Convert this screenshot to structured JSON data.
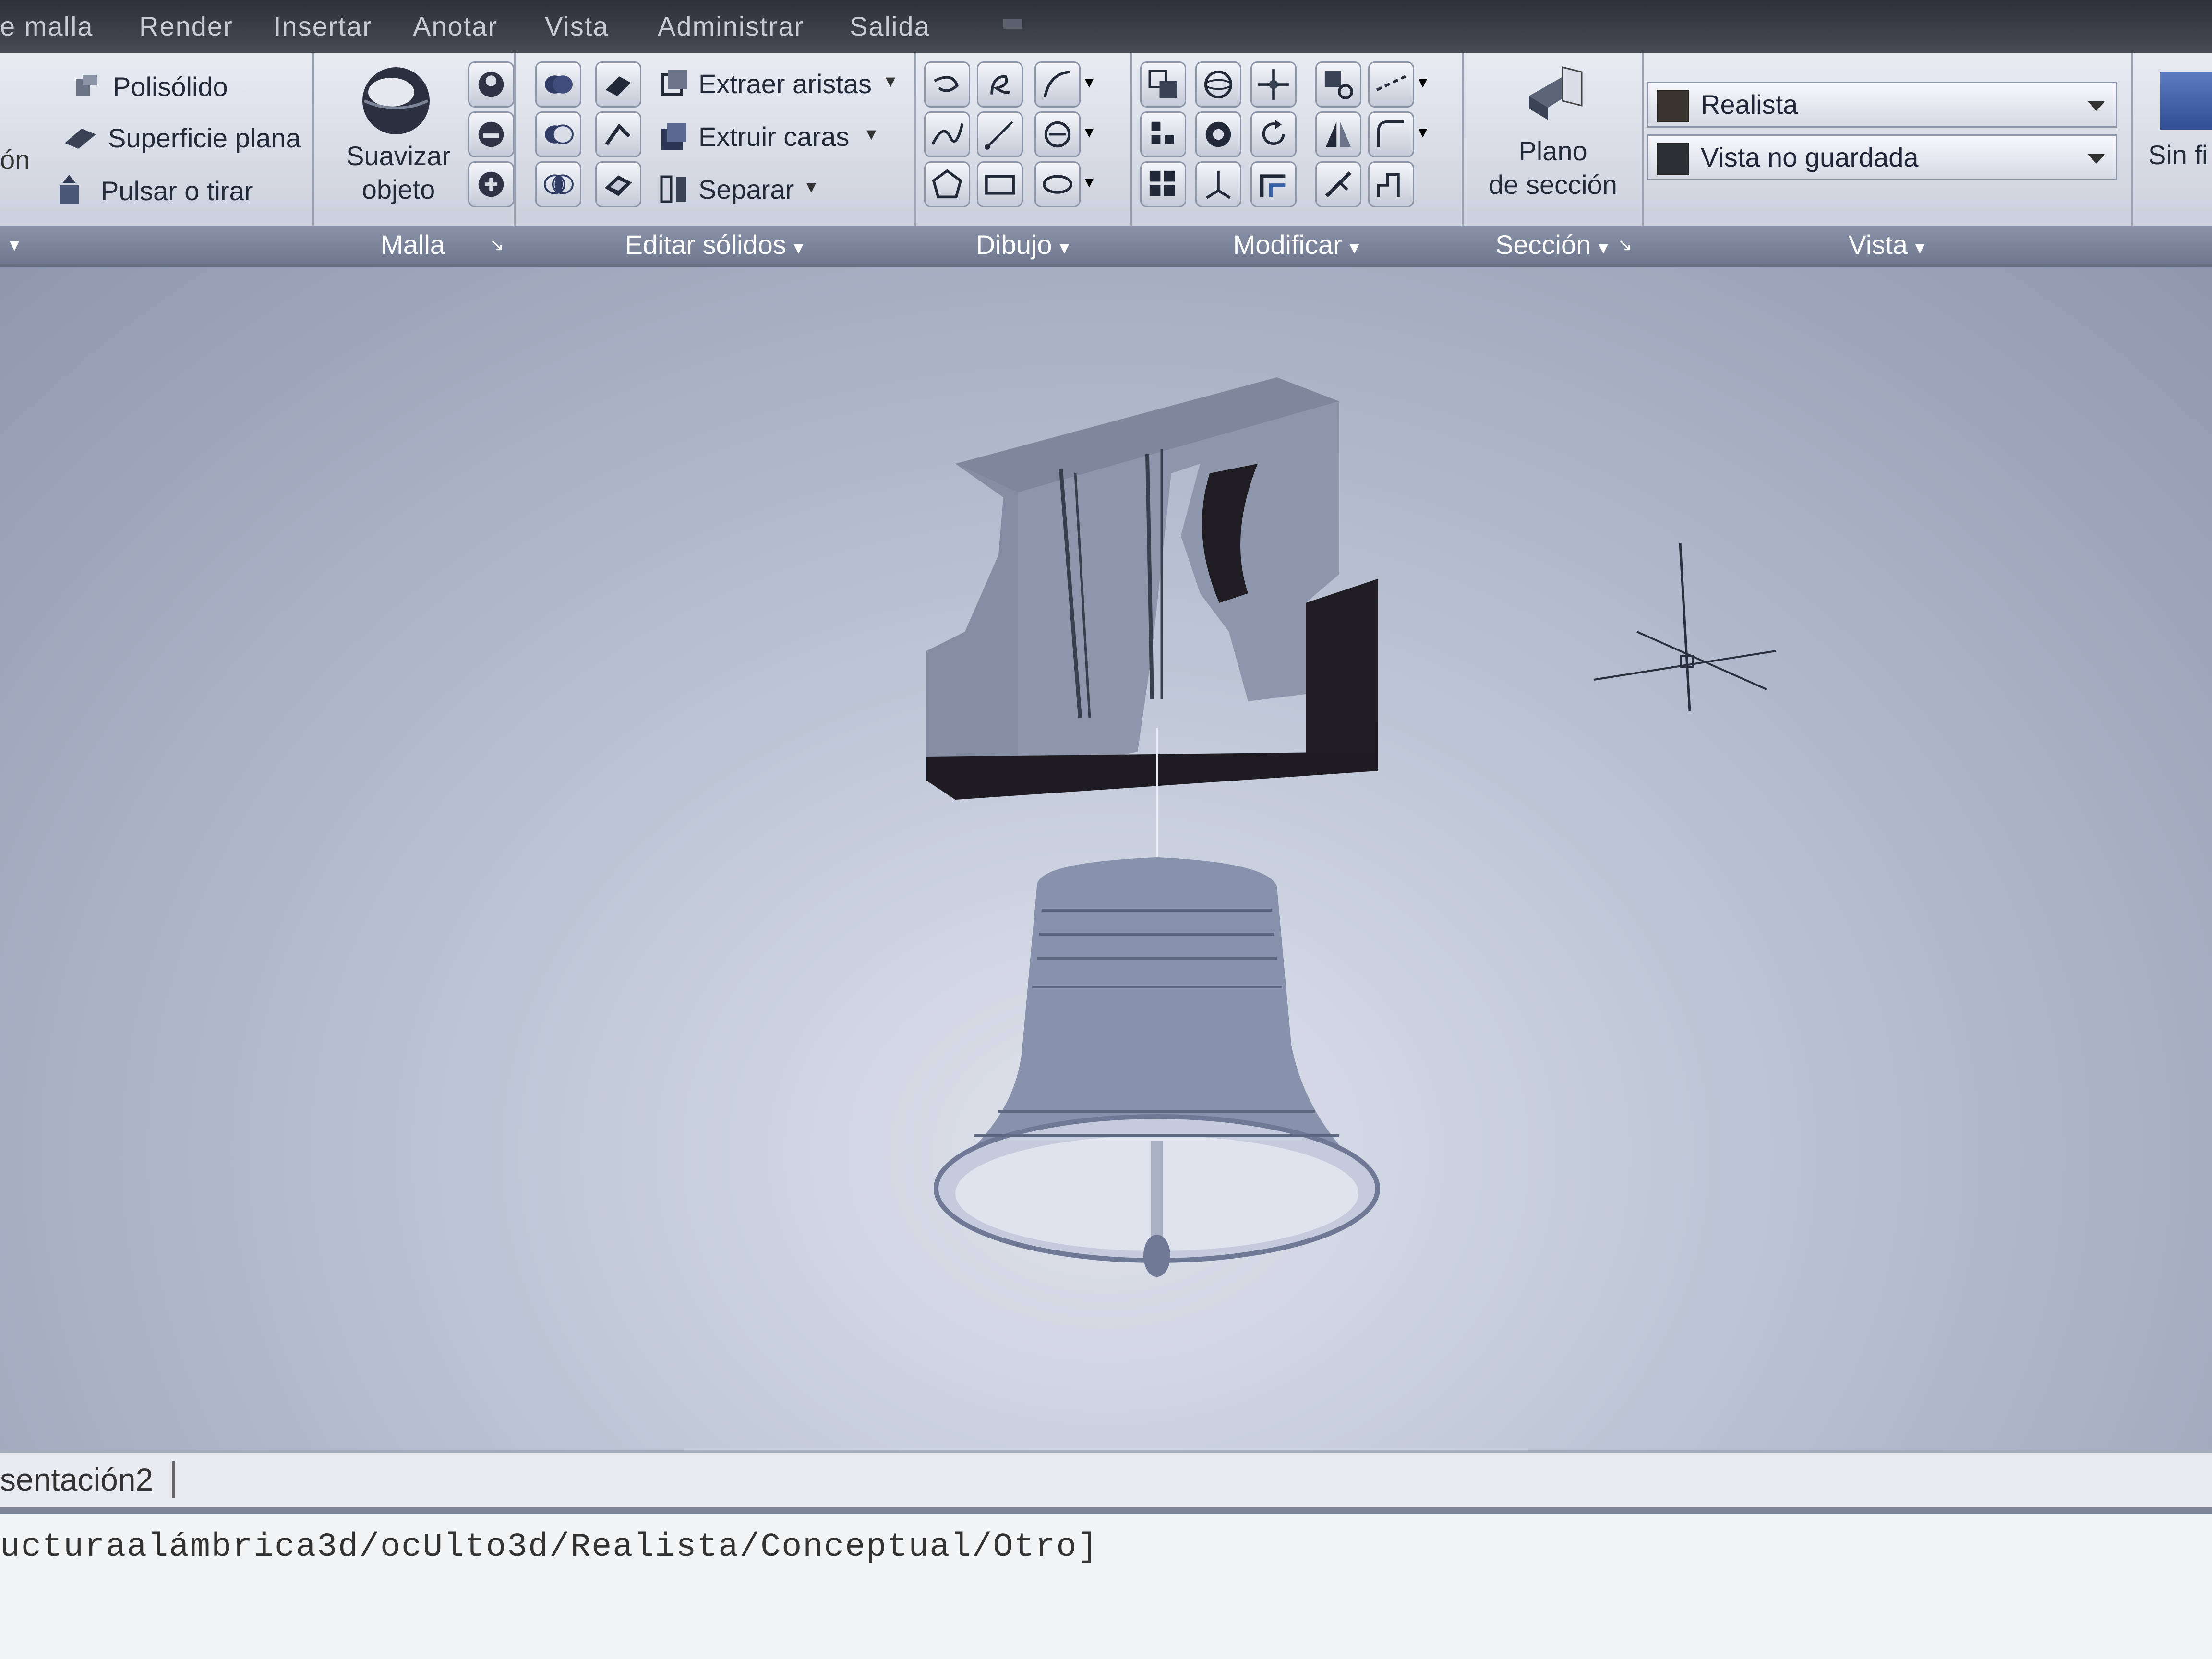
{
  "menu": {
    "items": [
      "e malla",
      "Render",
      "Insertar",
      "Anotar",
      "Vista",
      "Administrar",
      "Salida"
    ]
  },
  "ribbon": {
    "modelado": {
      "title": "",
      "items": [
        "Polisólido",
        "Superficie plana",
        "Pulsar o tirar"
      ],
      "left_fragment": "ón"
    },
    "malla": {
      "title": "Malla",
      "smooth_label_1": "Suavizar",
      "smooth_label_2": "objeto"
    },
    "editar_solidos": {
      "title": "Editar sólidos",
      "items": [
        "Extraer aristas",
        "Extruir caras",
        "Separar"
      ]
    },
    "dibujo": {
      "title": "Dibujo"
    },
    "modificar": {
      "title": "Modificar"
    },
    "seccion": {
      "title": "Sección",
      "btn_label_1": "Plano",
      "btn_label_2": "de sección"
    },
    "vista": {
      "title": "Vista",
      "visual_style": "Realista",
      "named_view": "Vista no guardada",
      "right_fragment": "Sin fi"
    }
  },
  "layout_tabs": {
    "current": "sentación2"
  },
  "command_line": {
    "text": "ucturaalámbrica3d/ocUlto3d/Realista/Conceptual/Otro]"
  },
  "colors": {
    "menubar": "#3a3f4a",
    "ribbon": "#d3d8e3",
    "panel_title": "#7a8399",
    "viewport_top": "#8f98ae",
    "model_face": "#8a93ad",
    "model_dark": "#1e1c22"
  }
}
